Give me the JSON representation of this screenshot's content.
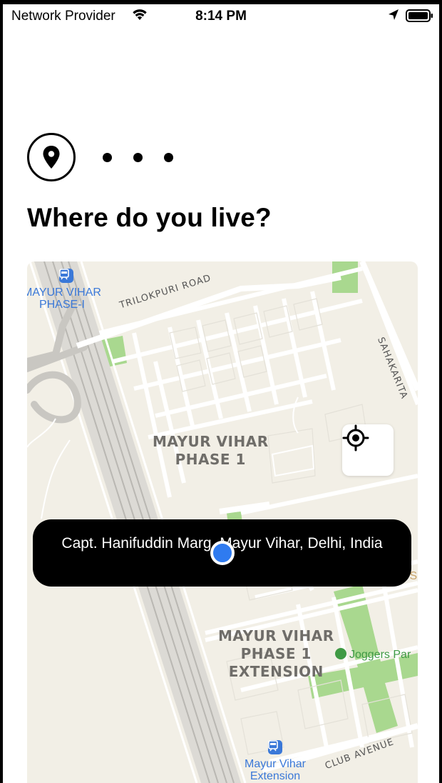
{
  "status_bar": {
    "carrier": "Network Provider",
    "time": "8:14 PM",
    "icons": [
      "wifi-icon",
      "location-arrow-icon",
      "battery-icon"
    ]
  },
  "progress": {
    "icon": "map-pin-icon",
    "remaining_steps": 3
  },
  "title": "Where do you live?",
  "map": {
    "labels": {
      "area_main": "MAYUR VIHAR\nPHASE 1",
      "area_extension": "MAYUR VIHAR\nPHASE 1\nEXTENSION",
      "road_trilokpuri": "TRILOKPURI ROAD",
      "road_sahakarita": "SAHAKARITA",
      "road_club_avenue": "CLUB AVENUE",
      "metro_top": "MAYUR VIHAR\nPHASE-I",
      "metro_bottom": "Mayur Vihar\nExtension",
      "park": "Joggers Par",
      "partial_s": "y S"
    },
    "locate_icon": "crosshair-target-icon",
    "address": "Capt. Hanifuddin Marg, Mayur Vihar, Delhi, India"
  },
  "colors": {
    "map_bg": "#f2efe6",
    "park_green": "#a9d88f",
    "metro_blue": "#3a78d8",
    "user_dot_blue": "#2f7bf0"
  }
}
